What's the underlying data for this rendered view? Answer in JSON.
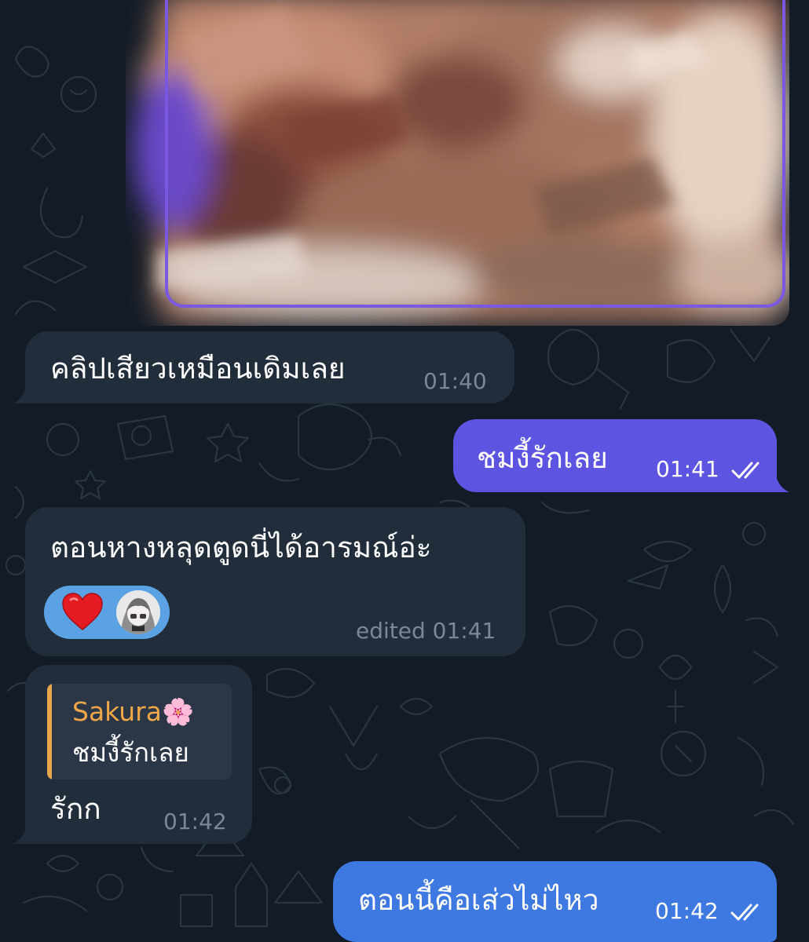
{
  "chat": {
    "background_color": "#131b26",
    "incoming_bubble_color": "#212d3b",
    "outgoing_purple_color": "#5d55e2",
    "outgoing_blue_color": "#3d79e0"
  },
  "media": {
    "icon": "blurred-image",
    "frame_color": "#7a58e0"
  },
  "messages": [
    {
      "direction": "incoming",
      "text": "คลิปเสียวเหมือนเดิมเลย",
      "time": "01:40"
    },
    {
      "direction": "outgoing",
      "text": "ชมงี้รักเลย",
      "time": "01:41",
      "status_icon": "double-check-icon"
    },
    {
      "direction": "incoming",
      "text": "ตอนหางหลุดตูดนี่ได้อารมณ์อ่ะ",
      "time": "edited 01:41",
      "reaction": {
        "emoji": "heart-icon",
        "avatar": "anime-avatar"
      }
    },
    {
      "direction": "incoming",
      "reply": {
        "name": "Sakura🌸",
        "text": "ชมงี้รักเลย"
      },
      "text": "รักก",
      "time": "01:42"
    },
    {
      "direction": "outgoing",
      "text": "ตอนนี้คือเส่วไม่ไหว",
      "time": "01:42",
      "status_icon": "double-check-icon"
    }
  ]
}
